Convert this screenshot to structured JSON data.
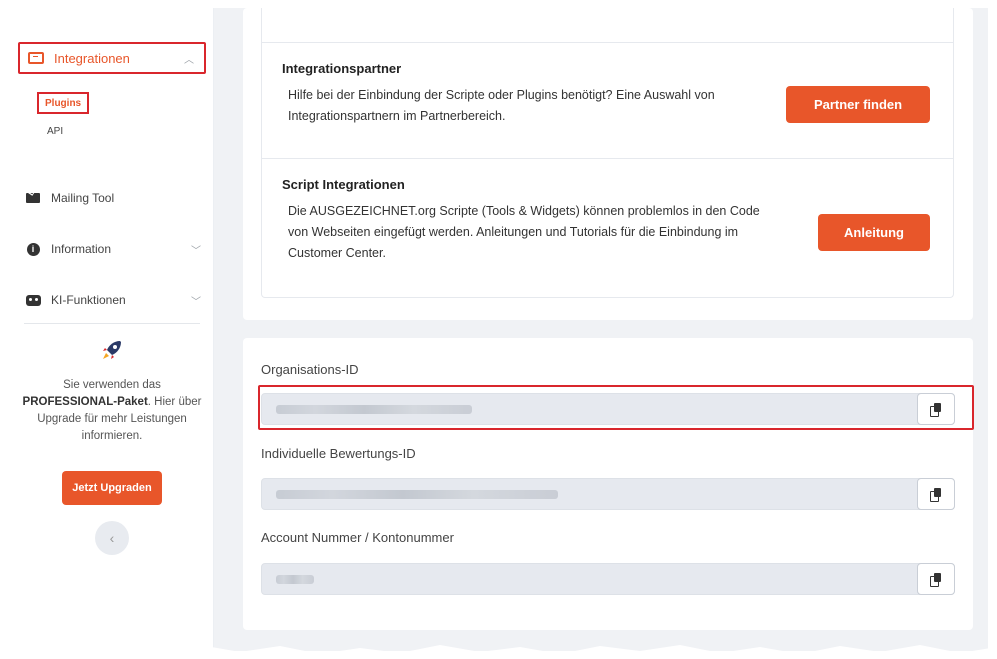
{
  "sidebar": {
    "integrations_label": "Integrationen",
    "plugins_label": "Plugins",
    "api_label": "API",
    "items": [
      {
        "label": "Mailing Tool",
        "icon": "envelope-icon"
      },
      {
        "label": "Information",
        "icon": "info-icon"
      },
      {
        "label": "KI-Funktionen",
        "icon": "robot-icon"
      }
    ],
    "promo": {
      "line1": "Sie verwenden das",
      "package": "PROFESSIONAL-Paket",
      "line2": ". Hier über Upgrade für mehr Leistungen informieren.",
      "button": "Jetzt Upgraden"
    }
  },
  "main": {
    "partner": {
      "title": "Integrationspartner",
      "text": "Hilfe bei der Einbindung der Scripte oder Plugins benötigt? Eine Auswahl von Integrationspartnern im Partnerbereich.",
      "button": "Partner finden"
    },
    "script": {
      "title": "Script Integrationen",
      "text": "Die AUSGEZEICHNET.org Scripte (Tools & Widgets) können problemlos in den Code von Webseiten eingefügt werden. Anleitungen und Tutorials für die Einbindung im Customer Center.",
      "button": "Anleitung"
    },
    "fields": [
      {
        "label": "Organisations-ID"
      },
      {
        "label": "Individuelle Bewertungs-ID"
      },
      {
        "label": "Account Nummer / Kontonummer"
      }
    ]
  },
  "colors": {
    "accent": "#e8562a",
    "highlight": "#d9262c",
    "background": "#f0f2f5"
  }
}
